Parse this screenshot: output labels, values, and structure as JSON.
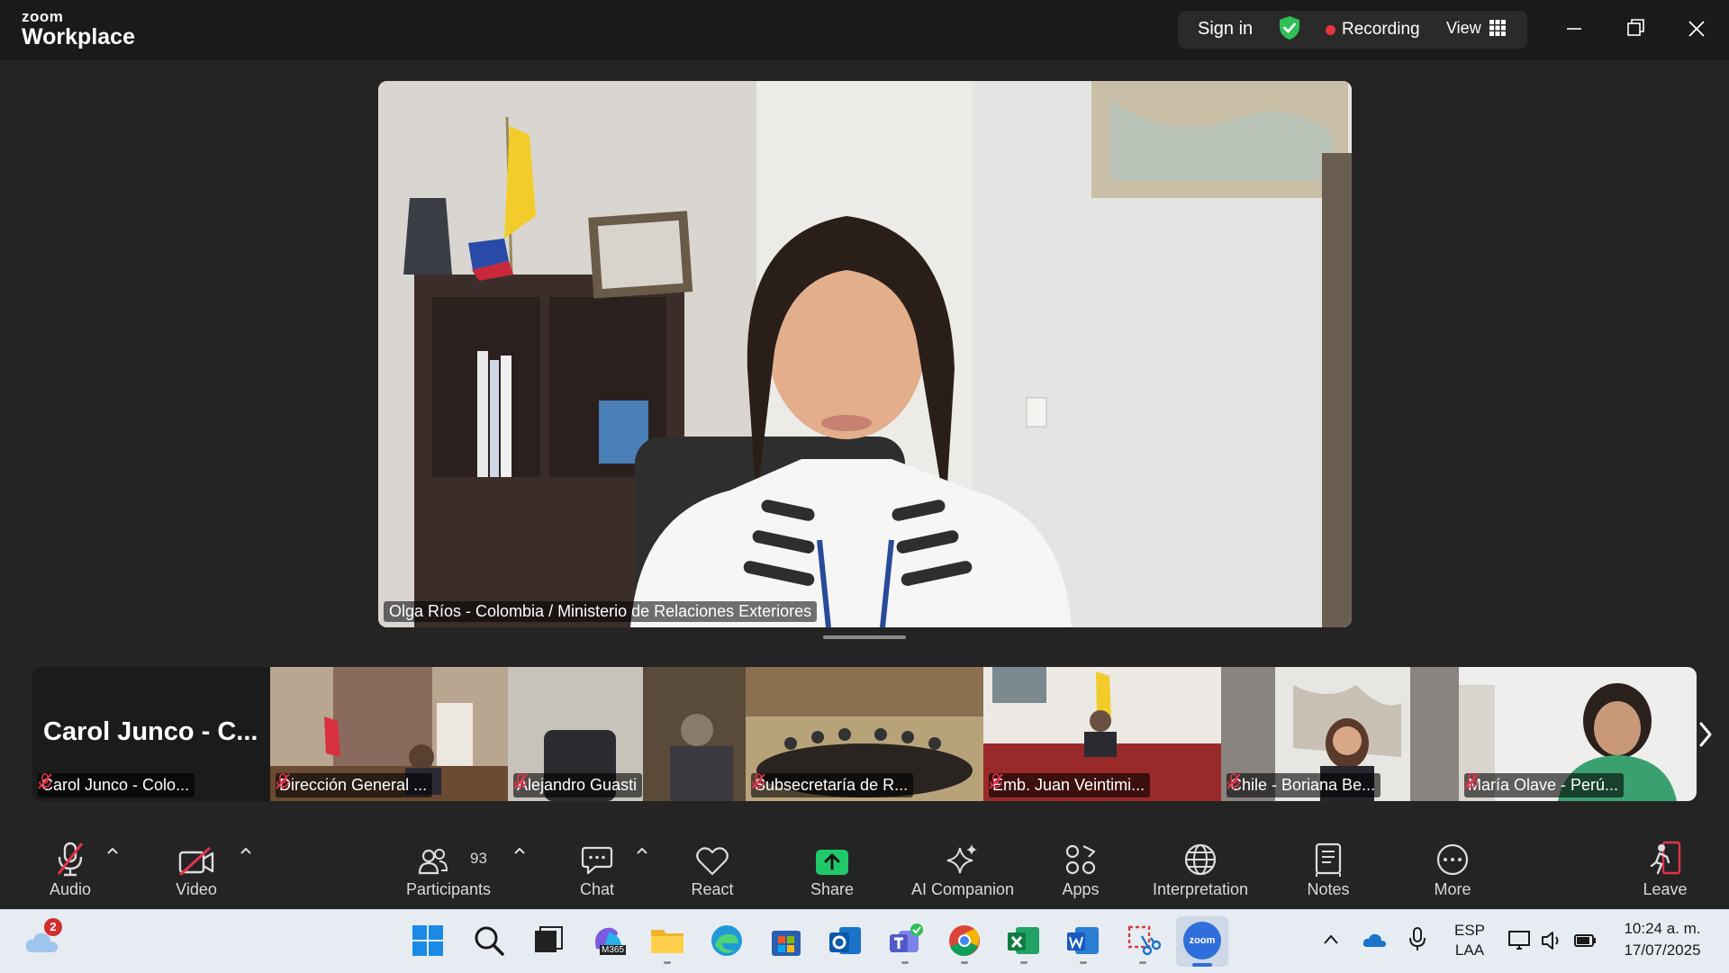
{
  "app": {
    "brand_top": "zoom",
    "brand_bottom": "Workplace"
  },
  "header": {
    "sign_in": "Sign in",
    "recording": "Recording",
    "view": "View"
  },
  "main_video": {
    "participant_name": "Olga Ríos - Colombia / Ministerio de Relaciones Exteriores"
  },
  "thumbnails": [
    {
      "big_name": "Carol Junco - C...",
      "name": "Carol Junco - Colo..."
    },
    {
      "name": "Dirección General ..."
    },
    {
      "name": "Alejandro Guasti"
    },
    {
      "name": "Subsecretaría de R..."
    },
    {
      "name": "Emb. Juan Veintimi..."
    },
    {
      "name": "Chile - Boriana Be..."
    },
    {
      "name": "María Olave - Perú..."
    }
  ],
  "toolbar": {
    "audio": "Audio",
    "video": "Video",
    "participants": "Participants",
    "participants_count": "93",
    "chat": "Chat",
    "react": "React",
    "share": "Share",
    "ai_companion": "AI Companion",
    "apps": "Apps",
    "interpretation": "Interpretation",
    "notes": "Notes",
    "more": "More",
    "leave": "Leave"
  },
  "taskbar": {
    "weather_badge": "2",
    "copilot_label": "M365",
    "zoom_label": "zoom",
    "lang_top": "ESP",
    "lang_bottom": "LAA",
    "time": "10:24 a. m.",
    "date": "17/07/2025"
  },
  "colors": {
    "background": "#242424",
    "titlebar": "#1a1a1a",
    "recording_dot": "#e8333a",
    "share_green": "#1fc96a",
    "leave_red": "#e0334a",
    "muted_red": "#e0334a"
  }
}
